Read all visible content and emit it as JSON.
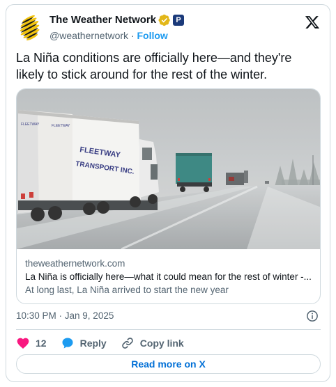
{
  "account": {
    "display_name": "The Weather Network",
    "handle": "@weathernetwork",
    "separator": "·",
    "follow_label": "Follow",
    "affiliate_badge": "P"
  },
  "tweet": {
    "text": "La Niña conditions are officially here—and they're likely to stick around for the rest of the winter."
  },
  "link_card": {
    "domain": "theweathernetwork.com",
    "title": "La Niña is officially here—what it could mean for the rest of winter -...",
    "description": "At long last, La Niña arrived to start the new year",
    "image_trailer_text": "FLEETWAY TRANSPORT INC."
  },
  "timestamp": "10:30 PM · Jan 9, 2025",
  "actions": {
    "like_count": "12",
    "reply_label": "Reply",
    "copy_link_label": "Copy link"
  },
  "read_more_label": "Read more on X",
  "colors": {
    "accent": "#1d9bf0",
    "like": "#f91880",
    "read_more": "#006fd6",
    "verified": "#e2b719"
  },
  "icons": [
    "x-logo-icon",
    "verified-badge-icon",
    "info-icon",
    "heart-icon",
    "reply-bubble-icon",
    "link-icon"
  ]
}
